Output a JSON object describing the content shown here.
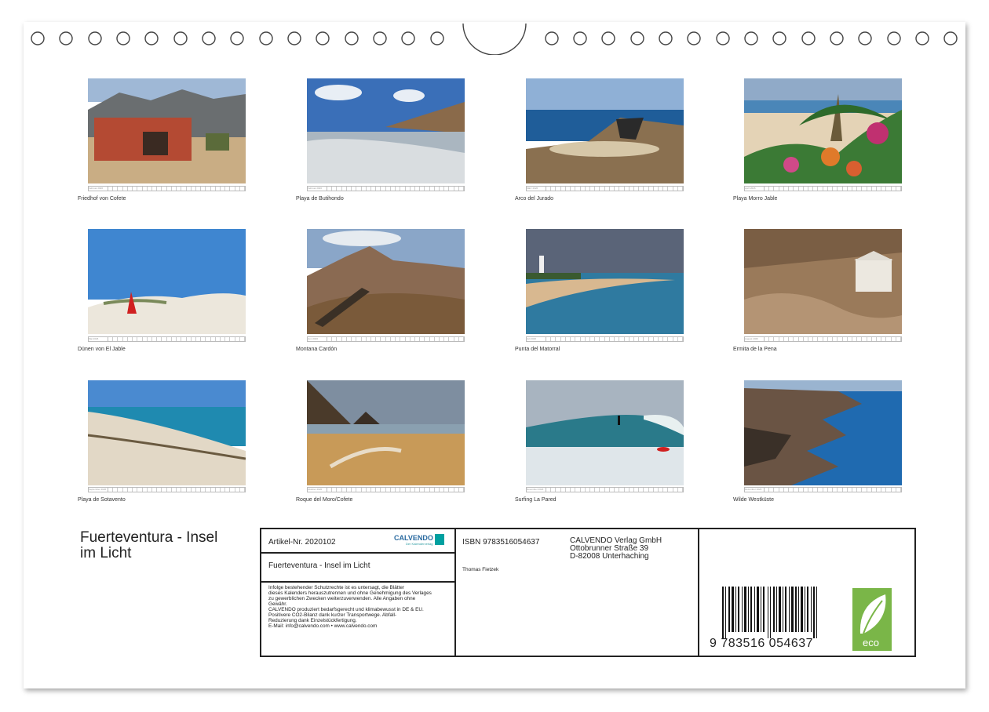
{
  "calendar": {
    "title": "Fuerteventura - Insel im Licht",
    "photos": [
      {
        "caption": "Friedhof von Cofete",
        "strip_label": "Februar 2026"
      },
      {
        "caption": "Playa de Butihondo",
        "strip_label": "Februar 2026"
      },
      {
        "caption": "Arco del Jurado",
        "strip_label": "März 2026"
      },
      {
        "caption": "Playa Morro Jable",
        "strip_label": "April 2026"
      },
      {
        "caption": "Dünen von El Jable",
        "strip_label": "Mai 2026"
      },
      {
        "caption": "Montana Cardón",
        "strip_label": "Juni 2026"
      },
      {
        "caption": "Punta del Matorral",
        "strip_label": "Juli 2026"
      },
      {
        "caption": "Ermita de la Pena",
        "strip_label": "August 2026"
      },
      {
        "caption": "Playa de Sotavento",
        "strip_label": "September 2026"
      },
      {
        "caption": "Roque del Moro/Cofete",
        "strip_label": "Oktober 2026"
      },
      {
        "caption": "Surfing La Pared",
        "strip_label": "November 2026"
      },
      {
        "caption": "Wilde Westküste",
        "strip_label": "Dezember 2026"
      }
    ]
  },
  "imprint": {
    "article_no": "Artikel-Nr. 2020102",
    "brand": "CALVENDO",
    "brand_sub": "Der Kalenderverlag",
    "product_title": "Fuerteventura - Insel im Licht",
    "legal_text": [
      "Infolge bestehender Schutzrechte ist es untersagt, die Blätter",
      "dieses Kalenders herauszutrennen und ohne Genehmigung des Verlages",
      "zu gewerblichen Zwecken weiterzuverwenden. Alle Angaben ohne",
      "Gewähr.",
      "CALVENDO produziert bedarfsgerecht und klimabewusst in DE & EU.",
      "Positivere CO2-Bilanz dank kurzer Transportwege. Abfall-",
      "Reduzierung dank Einzelstückfertigung.",
      "E-Mail: info@calvendo.com • www.calvendo.com"
    ],
    "isbn": "ISBN 9783516054637",
    "author": "Thomas Fietzek",
    "publisher": [
      "CALVENDO Verlag GmbH",
      "Ottobrunner Straße 39",
      "D-82008 Unterhaching"
    ],
    "barcode_text": "9 783516 054637",
    "eco_label": "eco"
  },
  "colors": {
    "frame": "#222222",
    "eco_green": "#7ab648",
    "brand_teal": "#00a0a0"
  }
}
